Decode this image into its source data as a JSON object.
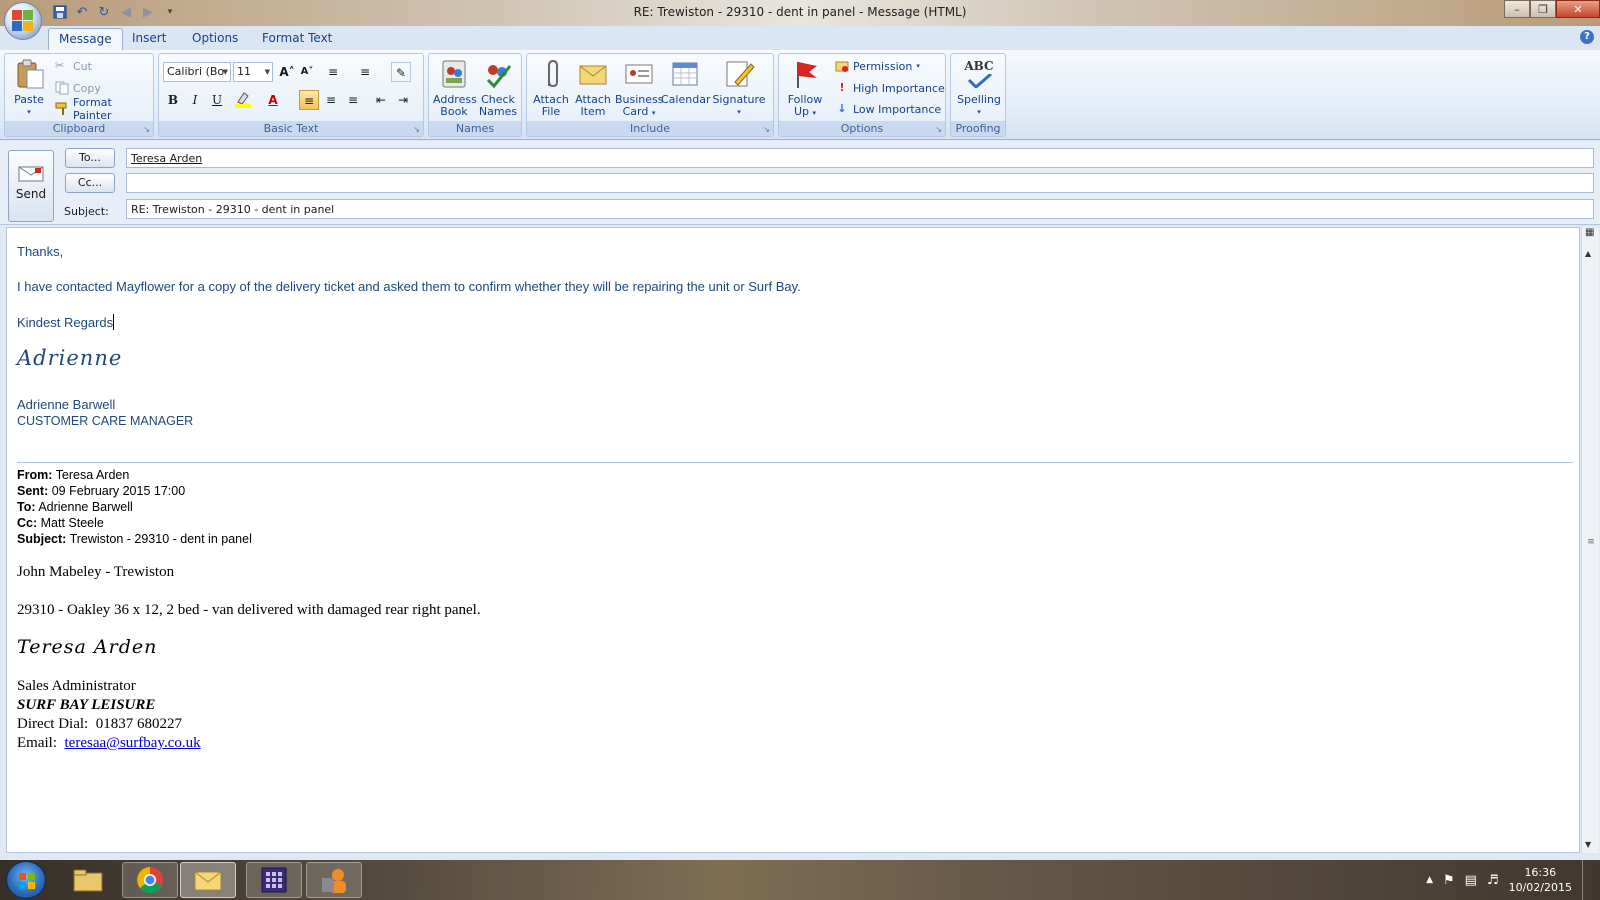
{
  "window": {
    "title": "RE: Trewiston - 29310 - dent in panel - Message (HTML)",
    "minimize": "–",
    "maximize": "❐",
    "close": "✕"
  },
  "ribbon": {
    "tabs": [
      {
        "label": "Message",
        "active": true
      },
      {
        "label": "Insert",
        "active": false
      },
      {
        "label": "Options",
        "active": false
      },
      {
        "label": "Format Text",
        "active": false
      }
    ],
    "help": "?",
    "clipboard": {
      "label": "Clipboard",
      "paste": "Paste",
      "cut": "Cut",
      "copy": "Copy",
      "format_painter": "Format Painter"
    },
    "basic_text": {
      "label": "Basic Text",
      "font": "Calibri (Bo",
      "size": "11",
      "bold": "B",
      "italic": "I",
      "underline": "U",
      "font_color": "A",
      "grow": "A˄",
      "shrink": "A˅"
    },
    "names": {
      "label": "Names",
      "address_book_1": "Address",
      "address_book_2": "Book",
      "check_names_1": "Check",
      "check_names_2": "Names"
    },
    "include": {
      "label": "Include",
      "attach_file_1": "Attach",
      "attach_file_2": "File",
      "attach_item_1": "Attach",
      "attach_item_2": "Item",
      "business_card_1": "Business",
      "business_card_2": "Card",
      "calendar": "Calendar",
      "signature": "Signature"
    },
    "options": {
      "label": "Options",
      "follow_up_1": "Follow",
      "follow_up_2": "Up",
      "permission": "Permission",
      "high_importance": "High Importance",
      "low_importance": "Low Importance"
    },
    "proofing": {
      "label": "Proofing",
      "spelling_icon_text": "ABC",
      "spelling": "Spelling"
    }
  },
  "header": {
    "send": "Send",
    "to_button": "To...",
    "cc_button": "Cc...",
    "subject_label": "Subject:",
    "to_value": "Teresa Arden",
    "cc_value": "",
    "subject_value": "RE: Trewiston - 29310 - dent in panel"
  },
  "body": {
    "greeting": "Thanks,",
    "message": "I have contacted Mayflower for a copy of the delivery ticket and asked them to confirm whether they will be repairing the unit or Surf Bay.",
    "closing": "Kindest Regards",
    "signature_script": "Adrienne",
    "signature_name": "Adrienne Barwell",
    "signature_title": "CUSTOMER CARE MANAGER",
    "quoted_header": {
      "from_label": "From:",
      "from": "Teresa Arden",
      "sent_label": "Sent:",
      "sent": "09 February 2015 17:00",
      "to_label": "To:",
      "to": "Adrienne Barwell",
      "cc_label": "Cc:",
      "cc": "Matt Steele",
      "subject_label": "Subject:",
      "subject": "Trewiston - 29310 - dent in panel"
    },
    "quoted_line1": "John Mabeley - Trewiston",
    "quoted_line2": "29310 - Oakley 36 x 12, 2 bed - van delivered with damaged rear right panel.",
    "quoted_signature_script": "Teresa Arden",
    "quoted_sig_title": "Sales Administrator",
    "quoted_sig_company": "SURF BAY LEISURE",
    "quoted_sig_dial": "Direct Dial:  01837 680227",
    "quoted_sig_email_label": "Email:",
    "quoted_sig_email": "teresaa@surfbay.co.uk"
  },
  "taskbar": {
    "time": "16:36",
    "date": "10/02/2015"
  },
  "colors": {
    "accent": "#15428b",
    "body_text": "#1f497d"
  }
}
